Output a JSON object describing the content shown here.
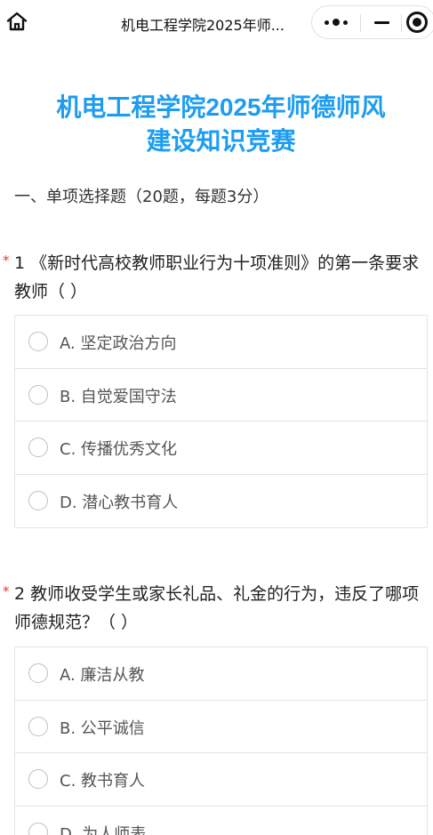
{
  "nav": {
    "title": "机电工程学院2025年师..."
  },
  "page": {
    "title_line1": "机电工程学院2025年师德师风",
    "title_line2": "建设知识竞赛",
    "section": "一、单项选择题（20题，每题3分）"
  },
  "questions": [
    {
      "required_mark": "*",
      "text": "1 《新时代高校教师职业行为十项准则》的第一条要求教师（    ）",
      "options": [
        "A. 坚定政治方向",
        "B. 自觉爱国守法",
        "C. 传播优秀文化",
        "D. 潜心教书育人"
      ]
    },
    {
      "required_mark": "*",
      "text": "2 教师收受学生或家长礼品、礼金的行为，违反了哪项师德规范？（    ）",
      "options": [
        "A. 廉洁从教",
        "B. 公平诚信",
        "C. 教书育人",
        "D. 为人师表"
      ]
    }
  ],
  "colors": {
    "title": "#1e9df0",
    "required": "#e53935",
    "border": "#e3e3e3"
  }
}
